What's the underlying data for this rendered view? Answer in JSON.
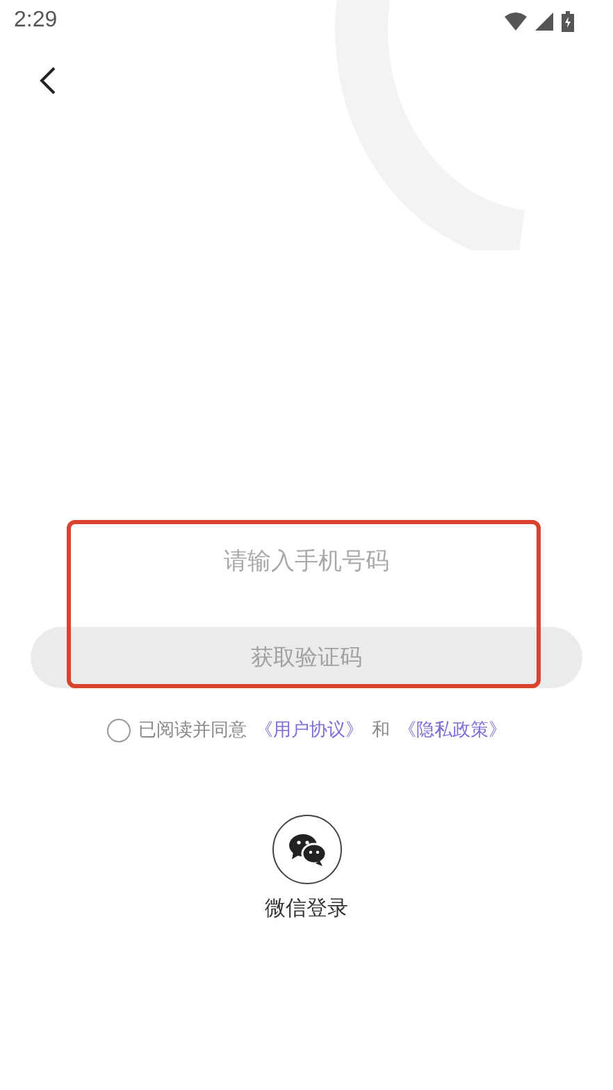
{
  "status_bar": {
    "time": "2:29"
  },
  "phone_field": {
    "placeholder": "请输入手机号码"
  },
  "code_button": {
    "label": "获取验证码",
    "disabled": true
  },
  "agreement": {
    "checked": false,
    "prefix": "已阅读并同意",
    "link_1": "《用户协议》",
    "joiner": "和",
    "link_2": "《隐私政策》"
  },
  "wechat_login": {
    "label": "微信登录"
  },
  "highlight": {
    "shown": true
  }
}
